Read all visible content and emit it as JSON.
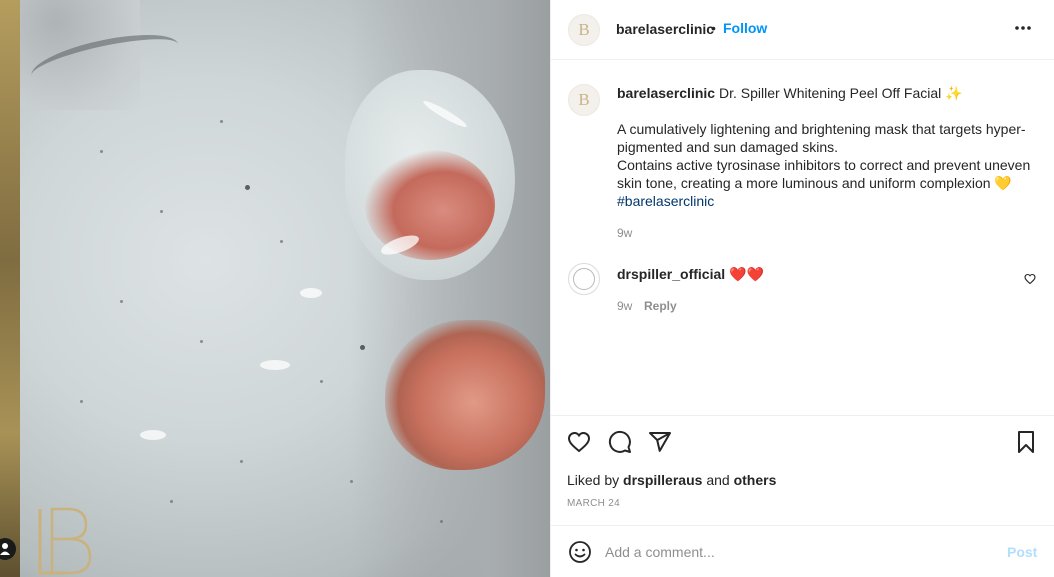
{
  "photo": {
    "logo_letters": "LB"
  },
  "header": {
    "username": "barelaserclinic",
    "separator": "•",
    "follow_label": "Follow",
    "avatar_letter": "B",
    "more_icon": "more-horizontal-icon"
  },
  "caption": {
    "username": "barelaserclinic",
    "title": "Dr. Spiller Whitening Peel Off Facial ✨",
    "body_line1": "A cumulatively lightening and brightening mask that targets hyper-pigmented and sun damaged skins.",
    "body_line2": "Contains active tyrosinase inhibitors to correct and prevent uneven skin tone, creating a more luminous and uniform complexion 💛",
    "hashtag": "#barelaserclinic",
    "time": "9w"
  },
  "comment": {
    "username": "drspiller_official",
    "text": "❤️❤️",
    "time": "9w",
    "reply_label": "Reply"
  },
  "actions": {
    "like_icon": "heart-icon",
    "comment_icon": "comment-icon",
    "share_icon": "send-icon",
    "save_icon": "bookmark-icon",
    "liked_by_prefix": "Liked by",
    "liked_by_user": "drspilleraus",
    "liked_by_and": "and",
    "liked_by_others": "others",
    "date": "MARCH 24"
  },
  "add_comment": {
    "emoji_icon": "smiley-icon",
    "placeholder": "Add a comment...",
    "post_label": "Post"
  },
  "colors": {
    "accent": "#0095f6",
    "post_disabled": "#b2dffc",
    "hashtag": "#00376b",
    "muted": "#8e8e8e"
  }
}
